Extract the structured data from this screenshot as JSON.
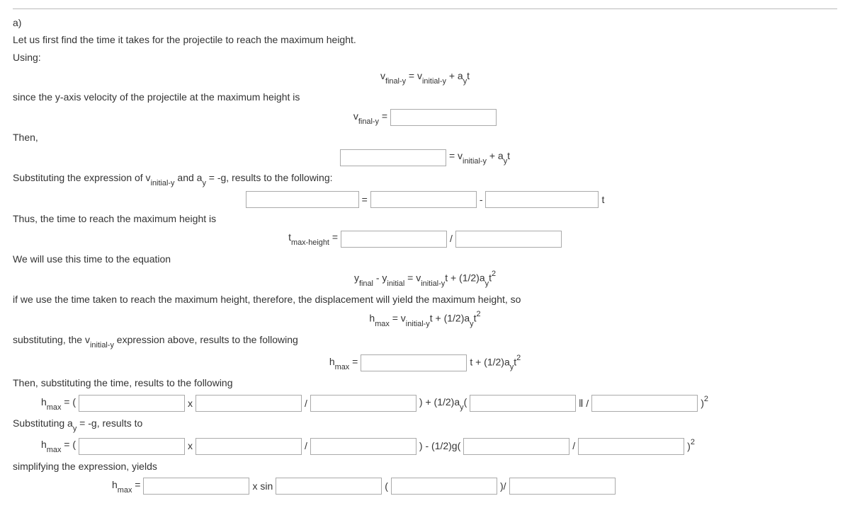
{
  "intro": {
    "part_label": "a)",
    "l1": "Let us first find the time it takes for the projectile to reach the maximum height.",
    "l2": "Using:",
    "eq1_pre": "v",
    "eq1_sub1": "final-y",
    "eq1_mid": " = v",
    "eq1_sub2": "initial-y",
    "eq1_post": " + a",
    "eq1_sub3": "y",
    "eq1_t": "t",
    "l3": "since the y-axis velocity of the projectile at the maximum height is",
    "eq2_label_v": "v",
    "eq2_label_sub": "final-y",
    "eq2_label_eq": " = ",
    "l4": "Then,",
    "eq3_mid": " = v",
    "eq3_sub": "initial-y",
    "eq3_post": " + a",
    "eq3_sub2": "y",
    "eq3_t": "t",
    "l5a": "Substituting the expression of v",
    "l5sub": "initial-y",
    "l5b": " and a",
    "l5sub2": "y",
    "l5c": " = -g, results to the following:",
    "eq4_equals": " = ",
    "eq4_minus": " - ",
    "eq4_t": " t",
    "l6": "Thus, the time to reach the maximum height is",
    "eq5_t": "t",
    "eq5_sub": "max-height",
    "eq5_eq": " = ",
    "eq5_slash": " / ",
    "l7": "We will use this time to the equation",
    "eq6_y1": "y",
    "eq6_sub1": "final",
    "eq6_dash": " - y",
    "eq6_sub2": "initial",
    "eq6_eq": " = v",
    "eq6_sub3": "initial-y",
    "eq6_t": "t + (1/2)a",
    "eq6_sub4": "y",
    "eq6_t2": "t",
    "eq6_sup": "2",
    "l8": "if we use the time taken to reach the maximum height, therefore, the displacement will yield the maximum height, so",
    "eq7_h": "h",
    "eq7_sub": "max",
    "eq7_eq": " = v",
    "eq7_sub2": "initial-y",
    "eq7_t": "t + (1/2)a",
    "eq7_sub3": "y",
    "eq7_t2": "t",
    "eq7_sup": "2",
    "l9a": "substituting, the v",
    "l9sub": "initial-y",
    "l9b": " expression above, results to the following",
    "eq8_h": "h",
    "eq8_sub": "max",
    "eq8_eq": " = ",
    "eq8_tplus": "t + (1/2)a",
    "eq8_sub2": "y",
    "eq8_t2": "t",
    "eq8_sup": "2",
    "l10": "Then, substituting the time, results to the following",
    "eq9_h": "h",
    "eq9_sub": "max",
    "eq9_eq": " = (",
    "eq9_x": " x ",
    "eq9_slash": " / ",
    "eq9_mid": ") + (1/2)a",
    "eq9_sub2": "y",
    "eq9_paren": "(",
    "eq9_icon": "⦀ /",
    "eq9_close": ")",
    "eq9_sup": "2",
    "l11a": "Substituting a",
    "l11sub": "y",
    "l11b": " = -g, results to",
    "eq10_h": "h",
    "eq10_sub": "max",
    "eq10_eq": " = (",
    "eq10_x": " x ",
    "eq10_slash": " / ",
    "eq10_mid": ") - (1/2)g(",
    "eq10_slash2": " / ",
    "eq10_close": ")",
    "eq10_sup": "2",
    "l12": "simplifying the expression, yields",
    "eq11_h": "h",
    "eq11_sub": "max",
    "eq11_eq": " = ",
    "eq11_xsin": " x sin",
    "eq11_open": " (",
    "eq11_close": ")/"
  }
}
